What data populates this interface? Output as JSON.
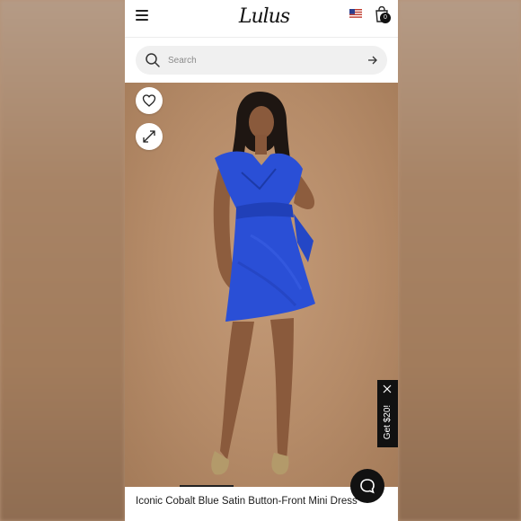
{
  "header": {
    "brand": "Lulus",
    "cart_count": "0"
  },
  "search": {
    "placeholder": "Search"
  },
  "promo": {
    "label": "Get $20!"
  },
  "product": {
    "title": "Iconic Cobalt Blue Satin Button-Front Mini Dress"
  },
  "colors": {
    "dress": "#2a4fd6",
    "background": "#b58b68",
    "accent": "#111111"
  },
  "icons": [
    "menu-icon",
    "flag-icon",
    "shopping-bag-icon",
    "search-icon",
    "arrow-right-icon",
    "heart-icon",
    "expand-icon",
    "close-icon",
    "chat-icon"
  ]
}
